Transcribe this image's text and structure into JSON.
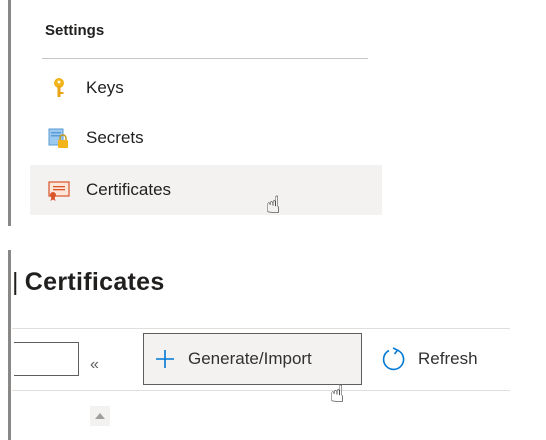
{
  "settings": {
    "header": "Settings",
    "items": [
      {
        "label": "Keys",
        "icon": "key-icon",
        "selected": false
      },
      {
        "label": "Secrets",
        "icon": "secret-icon",
        "selected": false
      },
      {
        "label": "Certificates",
        "icon": "certificate-icon",
        "selected": true
      }
    ]
  },
  "blade": {
    "pipe": "|",
    "title": "Certificates",
    "collapse_glyph": "«",
    "toolbar": {
      "generate_label": "Generate/Import",
      "refresh_label": "Refresh"
    }
  },
  "colors": {
    "accent": "#0078d4",
    "key_gold": "#f2b31b",
    "selected_bg": "#f3f2f1"
  }
}
